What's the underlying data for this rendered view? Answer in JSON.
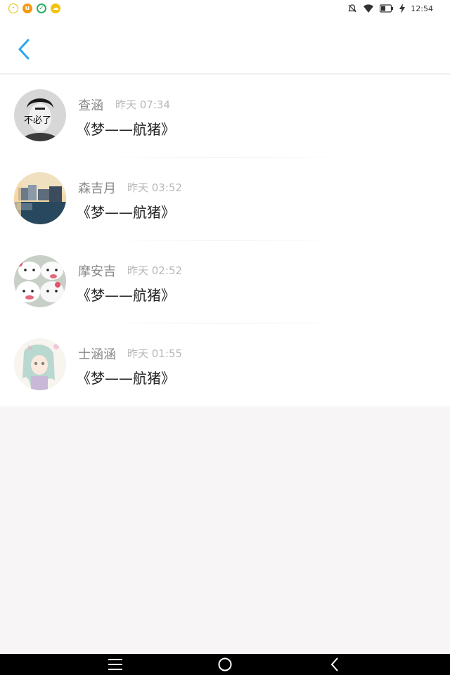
{
  "status_bar": {
    "time": "12:54",
    "left_icons": [
      "notification-app-icon",
      "uc-browser-icon",
      "check-app-icon",
      "cloud-app-icon"
    ],
    "right_icons": [
      "alarm-off-icon",
      "wifi-icon",
      "battery-icon",
      "charging-icon"
    ]
  },
  "header": {
    "back_icon": "chevron-left-icon"
  },
  "colors": {
    "accent": "#2aa7f0",
    "name": "#888888",
    "time": "#b8b8b8",
    "message": "#222222"
  },
  "list": {
    "items": [
      {
        "name": "查涵",
        "time": "昨天 07:34",
        "message": "《梦——航猪》",
        "avatar_text": "不必了"
      },
      {
        "name": "森吉月",
        "time": "昨天 03:52",
        "message": "《梦——航猪》"
      },
      {
        "name": "摩安吉",
        "time": "昨天 02:52",
        "message": "《梦——航猪》"
      },
      {
        "name": "士涵涵",
        "time": "昨天 01:55",
        "message": "《梦——航猪》"
      }
    ]
  },
  "nav_bar": {
    "icons": [
      "menu-icon",
      "home-icon",
      "back-icon"
    ]
  }
}
